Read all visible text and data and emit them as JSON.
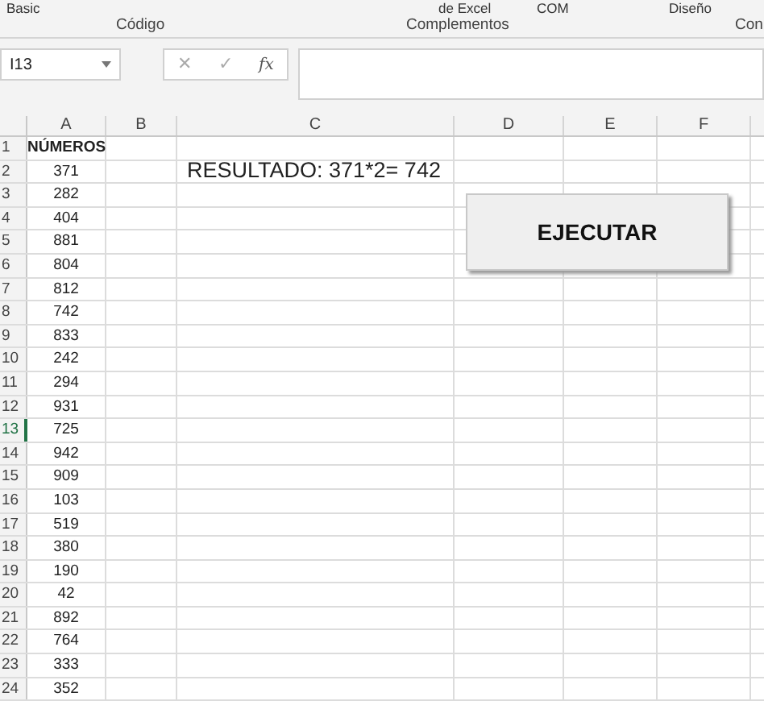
{
  "ribbon": {
    "items": [
      "Basic",
      "de Excel",
      "COM",
      "Diseño"
    ],
    "groups": [
      "Código",
      "Complementos",
      "Con"
    ]
  },
  "formula_bar": {
    "name_box": "I13",
    "cancel": "✕",
    "enter": "✓",
    "fx": "fx"
  },
  "columns": [
    "A",
    "B",
    "C",
    "D",
    "E",
    "F"
  ],
  "rows": [
    {
      "header": "1",
      "a": "NÚMEROS",
      "selected": false
    },
    {
      "header": "2",
      "a": "371",
      "selected": false
    },
    {
      "header": "3",
      "a": "282",
      "selected": false
    },
    {
      "header": "4",
      "a": "404",
      "selected": false
    },
    {
      "header": "5",
      "a": "881",
      "selected": false
    },
    {
      "header": "6",
      "a": "804",
      "selected": false
    },
    {
      "header": "7",
      "a": "812",
      "selected": false
    },
    {
      "header": "8",
      "a": "742",
      "selected": false
    },
    {
      "header": "9",
      "a": "833",
      "selected": false
    },
    {
      "header": "10",
      "a": "242",
      "selected": false
    },
    {
      "header": "11",
      "a": "294",
      "selected": false
    },
    {
      "header": "12",
      "a": "931",
      "selected": false
    },
    {
      "header": "13",
      "a": "725",
      "selected": true
    },
    {
      "header": "14",
      "a": "942",
      "selected": false
    },
    {
      "header": "15",
      "a": "909",
      "selected": false
    },
    {
      "header": "16",
      "a": "103",
      "selected": false
    },
    {
      "header": "17",
      "a": "519",
      "selected": false
    },
    {
      "header": "18",
      "a": "380",
      "selected": false
    },
    {
      "header": "19",
      "a": "190",
      "selected": false
    },
    {
      "header": "20",
      "a": "42",
      "selected": false
    },
    {
      "header": "21",
      "a": "892",
      "selected": false
    },
    {
      "header": "22",
      "a": "764",
      "selected": false
    },
    {
      "header": "23",
      "a": "333",
      "selected": false
    },
    {
      "header": "24",
      "a": "352",
      "selected": false
    }
  ],
  "result": "RESULTADO: 371*2= 742",
  "button": "EJECUTAR"
}
